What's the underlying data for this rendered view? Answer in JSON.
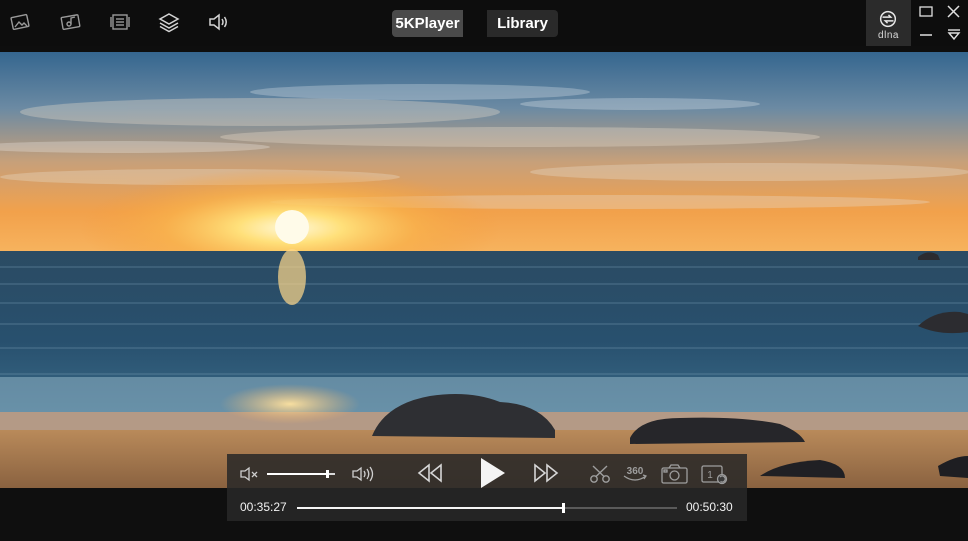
{
  "tabs": [
    {
      "label": "5KPlayer",
      "active": true
    },
    {
      "label": "Library",
      "active": false
    }
  ],
  "toolbar": {
    "icons": [
      "video-icon",
      "music-icon",
      "playlist-icon",
      "layers-icon",
      "speaker-icon"
    ]
  },
  "dlna": {
    "label": "dlna"
  },
  "window_controls": [
    "maximize-icon",
    "close-icon",
    "minimize-icon",
    "dropdown-icon"
  ],
  "player": {
    "current_time": "00:35:27",
    "total_time": "00:50:30",
    "progress": 0.7,
    "volume": 0.88,
    "state": "paused"
  },
  "controls": {
    "icons": [
      "mute-icon",
      "volume-up-icon",
      "rewind-icon",
      "play-icon",
      "fast-forward-icon",
      "cut-icon",
      "360-icon",
      "snapshot-icon",
      "rotate-icon"
    ],
    "label_360": "360",
    "label_rotate": "1"
  },
  "colors": {
    "accent": "#ffffff",
    "bar_bg": "#0d0d0d",
    "tab_active": "#4a4a4a",
    "tab_inactive": "#2a2a2a"
  }
}
